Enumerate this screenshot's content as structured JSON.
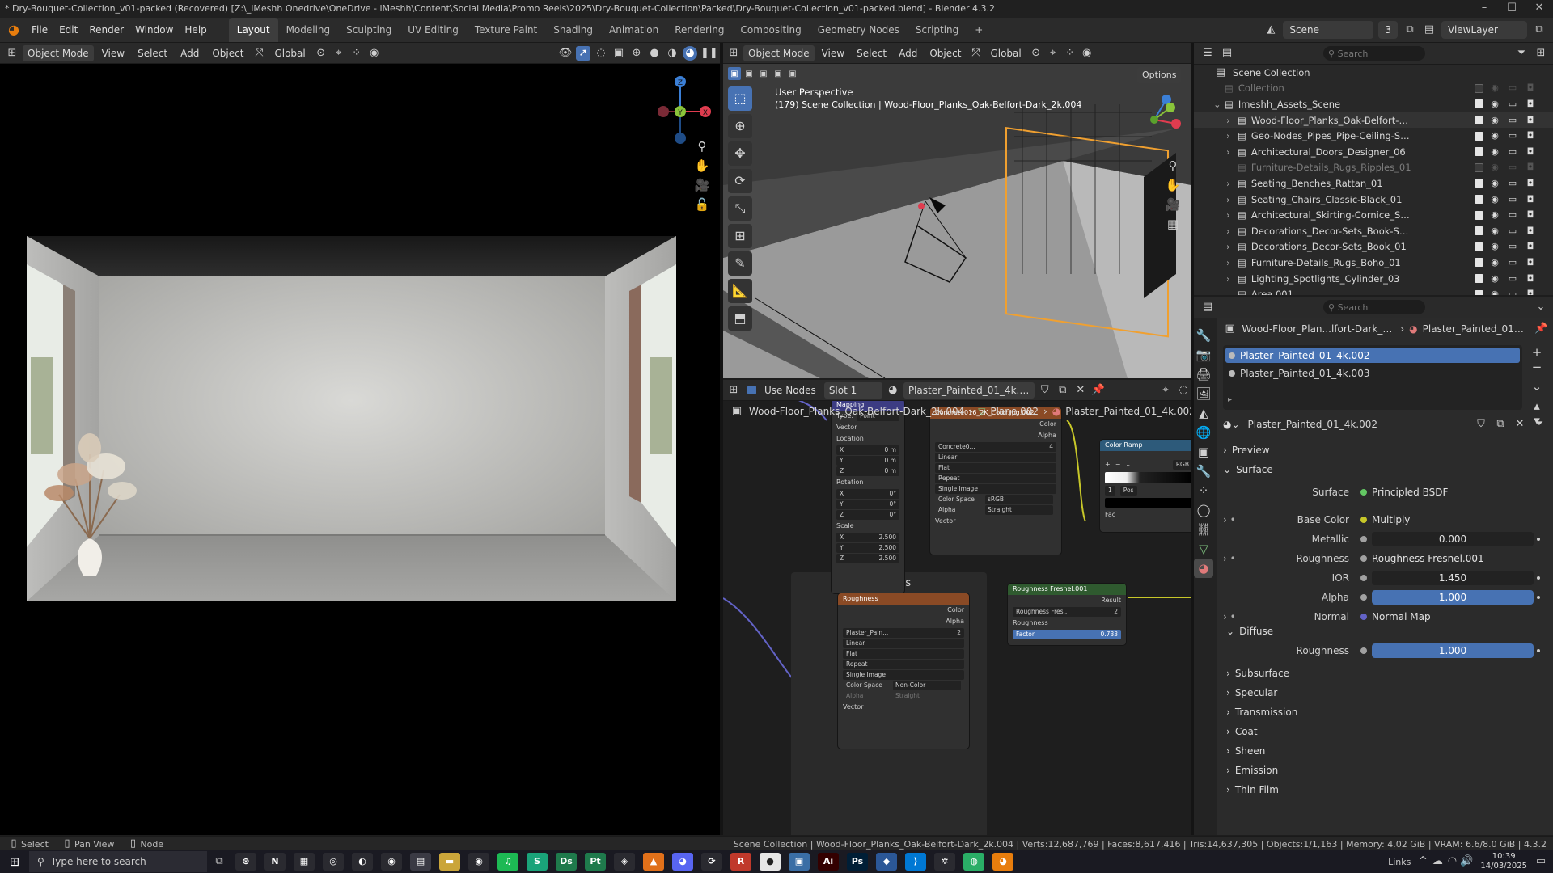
{
  "window": {
    "title": "* Dry-Bouquet-Collection_v01-packed (Recovered) [Z:\\_iMeshh Onedrive\\OneDrive - iMeshh\\Content\\Social Media\\Promo Reels\\2025\\Dry-Bouquet-Collection\\Packed\\Dry-Bouquet-Collection_v01-packed.blend] - Blender 4.3.2",
    "minimize": "–",
    "maximize": "☐",
    "close": "✕"
  },
  "menu": [
    "File",
    "Edit",
    "Render",
    "Window",
    "Help"
  ],
  "workspaces": [
    "Layout",
    "Modeling",
    "Sculpting",
    "UV Editing",
    "Texture Paint",
    "Shading",
    "Animation",
    "Rendering",
    "Compositing",
    "Geometry Nodes",
    "Scripting"
  ],
  "workspace_add": "+",
  "scene": {
    "name": "Scene",
    "users": "3",
    "view_layer": "ViewLayer"
  },
  "left_viewport": {
    "mode": "Object Mode",
    "menus": [
      "View",
      "Select",
      "Add",
      "Object"
    ],
    "orientation": "Global",
    "gizmo": {
      "x": "X",
      "y": "Y",
      "z": "Z"
    }
  },
  "right_viewport": {
    "mode": "Object Mode",
    "menus": [
      "View",
      "Select",
      "Add",
      "Object"
    ],
    "orientation": "Global",
    "options": "Options",
    "perspective": "User Perspective",
    "context": "(179) Scene Collection | Wood-Floor_Planks_Oak-Belfort-Dark_2k.004"
  },
  "outliner": {
    "search_placeholder": "Search",
    "root": "Scene Collection",
    "items": [
      {
        "name": "Collection",
        "level": 1,
        "dim": true,
        "expand": ""
      },
      {
        "name": "Imeshh_Assets_Scene",
        "level": 1,
        "dim": false,
        "expand": "⌄"
      },
      {
        "name": "Wood-Floor_Planks_Oak-Belfort-Dark_2K",
        "level": 2,
        "dim": false,
        "expand": "›"
      },
      {
        "name": "Geo-Nodes_Pipes_Pipe-Ceiling-Set_01",
        "level": 2,
        "dim": false,
        "expand": "›"
      },
      {
        "name": "Architectural_Doors_Designer_06",
        "level": 2,
        "dim": false,
        "expand": "›"
      },
      {
        "name": "Furniture-Details_Rugs_Ripples_01",
        "level": 2,
        "dim": true,
        "expand": ""
      },
      {
        "name": "Seating_Benches_Rattan_01",
        "level": 2,
        "dim": false,
        "expand": "›"
      },
      {
        "name": "Seating_Chairs_Classic-Black_01",
        "level": 2,
        "dim": false,
        "expand": "›"
      },
      {
        "name": "Architectural_Skirting-Cornice_Skirting-Set_03",
        "level": 2,
        "dim": false,
        "expand": "›"
      },
      {
        "name": "Decorations_Decor-Sets_Book-Shelf_23",
        "level": 2,
        "dim": false,
        "expand": "›"
      },
      {
        "name": "Decorations_Decor-Sets_Book_01",
        "level": 2,
        "dim": false,
        "expand": "›"
      },
      {
        "name": "Furniture-Details_Rugs_Boho_01",
        "level": 2,
        "dim": false,
        "expand": "›"
      },
      {
        "name": "Lighting_Spotlights_Cylinder_03",
        "level": 2,
        "dim": false,
        "expand": "›"
      },
      {
        "name": "Area.001",
        "level": 2,
        "dim": false,
        "expand": ""
      }
    ]
  },
  "properties": {
    "search_placeholder": "Search",
    "breadcrumb_object": "Wood-Floor_Plan...lfort-Dark_2k.004",
    "breadcrumb_material": "Plaster_Painted_01_...",
    "slots": [
      "Plaster_Painted_01_4k.002",
      "Plaster_Painted_01_4k.003"
    ],
    "material_name": "Plaster_Painted_01_4k.002",
    "panels": {
      "preview": "Preview",
      "surface": "Surface",
      "diffuse": "Diffuse"
    },
    "rows": [
      {
        "label": "Surface",
        "value": "Principled BSDF",
        "type": "link",
        "socket": "#63c763",
        "expand": false
      },
      {
        "label": "Base Color",
        "value": "Multiply",
        "type": "link",
        "socket": "#c7c729",
        "expand": true
      },
      {
        "label": "Metallic",
        "value": "0.000",
        "type": "num",
        "socket": "#a1a1a1",
        "expand": false
      },
      {
        "label": "Roughness",
        "value": "Roughness Fresnel.001",
        "type": "link",
        "socket": "#a1a1a1",
        "expand": true
      },
      {
        "label": "IOR",
        "value": "1.450",
        "type": "num",
        "socket": "#a1a1a1",
        "expand": false
      },
      {
        "label": "Alpha",
        "value": "1.000",
        "type": "blue",
        "socket": "#a1a1a1",
        "expand": false
      },
      {
        "label": "Normal",
        "value": "Normal Map",
        "type": "link",
        "socket": "#6363c7",
        "expand": true
      }
    ],
    "diffuse_roughness": {
      "label": "Roughness",
      "value": "1.000"
    },
    "collapsed_panels": [
      "Subsurface",
      "Specular",
      "Transmission",
      "Coat",
      "Sheen",
      "Emission",
      "Thin Film"
    ]
  },
  "node_editor": {
    "use_nodes": "Use Nodes",
    "slot": "Slot 1",
    "material": "Plaster_Painted_01_4k.002",
    "breadcrumb": [
      "Wood-Floor_Planks_Oak-Belfort-Dark_2k.004",
      "Plane.002",
      "Plaster_Painted_01_4k.002"
    ],
    "frame_label": "Textures",
    "mapping": {
      "title": "Mapping",
      "type_label": "Type:",
      "type_value": "Point",
      "vector": "Vector",
      "location": "Location",
      "rotation": "Rotation",
      "scale": "Scale",
      "loc": [
        "0 m",
        "0 m",
        "0 m"
      ],
      "rot": [
        "0°",
        "0°",
        "0°"
      ],
      "scl": [
        "2.500",
        "2.500",
        "2.500"
      ],
      "axes": [
        "X",
        "Y",
        "Z"
      ]
    },
    "concrete": {
      "title": "Concrete016_2K_Color.jpg.002",
      "image": "Concrete0...",
      "users": "4",
      "out_color": "Color",
      "out_alpha": "Alpha",
      "opts": [
        "Linear",
        "Flat",
        "Repeat",
        "Single Image"
      ],
      "cs_label": "Color Space",
      "cs_value": "sRGB",
      "alpha_label": "Alpha",
      "alpha_value": "Straight",
      "vector": "Vector"
    },
    "ramp": {
      "title": "Color Ramp",
      "mode": "RGB",
      "index": "1",
      "pos": "Pos",
      "fac": "Fac"
    },
    "roughness_tex": {
      "title": "Roughness",
      "image": "Plaster_Pain...",
      "users": "2",
      "out_color": "Color",
      "out_alpha": "Alpha",
      "opts": [
        "Linear",
        "Flat",
        "Repeat",
        "Single Image"
      ],
      "cs_label": "Color Space",
      "cs_value": "Non-Color",
      "alpha_label": "Alpha",
      "alpha_value": "Straight",
      "vector": "Vector"
    },
    "fresnel": {
      "title": "Roughness Fresnel.001",
      "group": "Roughness Fres...",
      "users": "2",
      "result": "Result",
      "roughness": "Roughness",
      "factor_label": "Factor",
      "factor_value": "0.733"
    }
  },
  "status_bar": {
    "hints": [
      "Select",
      "Pan View",
      "Node"
    ],
    "info": "Scene Collection | Wood-Floor_Planks_Oak-Belfort-Dark_2k.004 | Verts:12,687,769 | Faces:8,617,416 | Tris:14,637,305 | Objects:1/1,163 | Memory: 4.02 GiB | VRAM: 6.6/8.0 GiB | 4.3.2"
  },
  "taskbar": {
    "search_placeholder": "Type here to search",
    "links": "Links",
    "time": "10:39",
    "date": "14/03/2025",
    "apps": [
      {
        "name": "chatgpt",
        "label": "⊛",
        "color": "#2a2a30"
      },
      {
        "name": "notion",
        "label": "N",
        "color": "#2a2a30"
      },
      {
        "name": "calculator",
        "label": "▦",
        "color": "#2a2a30"
      },
      {
        "name": "app-4",
        "label": "◎",
        "color": "#2a2a30"
      },
      {
        "name": "app-5",
        "label": "◐",
        "color": "#2a2a30"
      },
      {
        "name": "chrome",
        "label": "◉",
        "color": "#2a2a30"
      },
      {
        "name": "calc",
        "label": "▤",
        "color": "#3a3a44"
      },
      {
        "name": "explorer",
        "label": "▬",
        "color": "#caa53a"
      },
      {
        "name": "chrome-2",
        "label": "◉",
        "color": "#2a2a30"
      },
      {
        "name": "spotify",
        "label": "♫",
        "color": "#1db954"
      },
      {
        "name": "app-s",
        "label": "S",
        "color": "#1aa37a"
      },
      {
        "name": "designer",
        "label": "Ds",
        "color": "#1f7a4c"
      },
      {
        "name": "painter",
        "label": "Pt",
        "color": "#1f7a4c"
      },
      {
        "name": "app-github",
        "label": "◈",
        "color": "#2a2a30"
      },
      {
        "name": "vlc",
        "label": "▲",
        "color": "#e0701a"
      },
      {
        "name": "discord",
        "label": "◕",
        "color": "#5865f2"
      },
      {
        "name": "app-sync",
        "label": "⟳",
        "color": "#2a2a30"
      },
      {
        "name": "app-r",
        "label": "R",
        "color": "#c0392b"
      },
      {
        "name": "app-circle",
        "label": "●",
        "color": "#e6e6e6"
      },
      {
        "name": "app-photo",
        "label": "▣",
        "color": "#3a6ea5"
      },
      {
        "name": "illustrator",
        "label": "Ai",
        "color": "#330000"
      },
      {
        "name": "photoshop",
        "label": "Ps",
        "color": "#001e36"
      },
      {
        "name": "app-blue",
        "label": "◆",
        "color": "#2b5797"
      },
      {
        "name": "vscode",
        "label": "⟩",
        "color": "#0078d4"
      },
      {
        "name": "app-settings",
        "label": "✲",
        "color": "#2a2a30"
      },
      {
        "name": "wechat",
        "label": "◍",
        "color": "#2aae67"
      },
      {
        "name": "blender",
        "label": "◕",
        "color": "#e87d0d"
      }
    ]
  },
  "colors": {
    "accent": "#4772b3",
    "selection_outline": "#f0a030",
    "axis_x": "#e03c4f",
    "axis_y": "#8ac43a",
    "axis_z": "#3b7fd6"
  }
}
